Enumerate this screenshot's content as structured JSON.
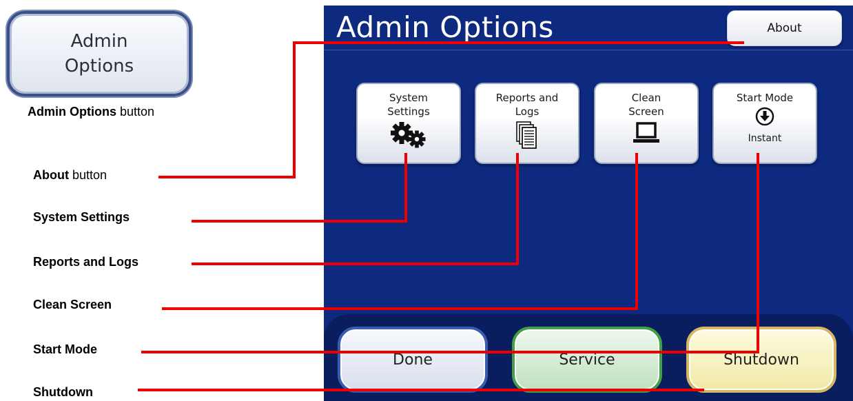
{
  "callout_button": {
    "line1": "Admin",
    "line2": "Options"
  },
  "callout_caption": {
    "bold": "Admin Options",
    "rest": " button"
  },
  "labels": {
    "about": {
      "bold": "About",
      "rest": " button"
    },
    "system_settings": "System Settings",
    "reports_logs": "Reports and Logs",
    "clean_screen": "Clean Screen",
    "start_mode": "Start Mode",
    "shutdown": "Shutdown"
  },
  "screen": {
    "title": "Admin Options",
    "about_label": "About",
    "tiles": [
      {
        "line1": "System",
        "line2": "Settings",
        "icon": "gears-icon"
      },
      {
        "line1": "Reports and",
        "line2": "Logs",
        "icon": "documents-icon"
      },
      {
        "line1": "Clean",
        "line2": "Screen",
        "icon": "laptop-icon"
      },
      {
        "line1": "Start Mode",
        "icon": "down-arrow-circle-icon",
        "sub": "Instant"
      }
    ],
    "buttons": {
      "done": "Done",
      "service": "Service",
      "shutdown": "Shutdown"
    }
  },
  "colors": {
    "screen_bg": "#0e2a80",
    "leader_line": "#ee0000",
    "done_border": "#3a5cae",
    "service_border": "#42a047",
    "shutdown_border": "#d6b862"
  }
}
